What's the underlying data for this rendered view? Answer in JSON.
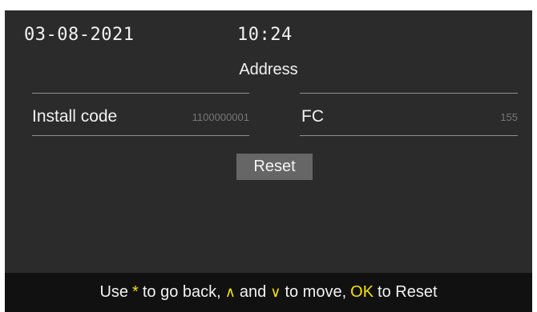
{
  "status": {
    "date": "03-08-2021",
    "time": "10:24"
  },
  "page": {
    "title": "Address"
  },
  "fields": {
    "install_code": {
      "label": "Install code",
      "value": "1100000001"
    },
    "fc": {
      "label": "FC",
      "value": "155"
    }
  },
  "actions": {
    "reset_label": "Reset"
  },
  "hint": {
    "text_use": "Use",
    "key_back": "*",
    "text_back": "to go back,",
    "key_up": "∧",
    "text_and": "and",
    "key_down": "∨",
    "text_move": "to move,",
    "key_ok": "OK",
    "text_reset": "to Reset",
    "key_color": "#f4e300"
  },
  "icons": {
    "up": "up-arrow-icon",
    "down": "down-arrow-icon",
    "back": "asterisk-icon"
  }
}
